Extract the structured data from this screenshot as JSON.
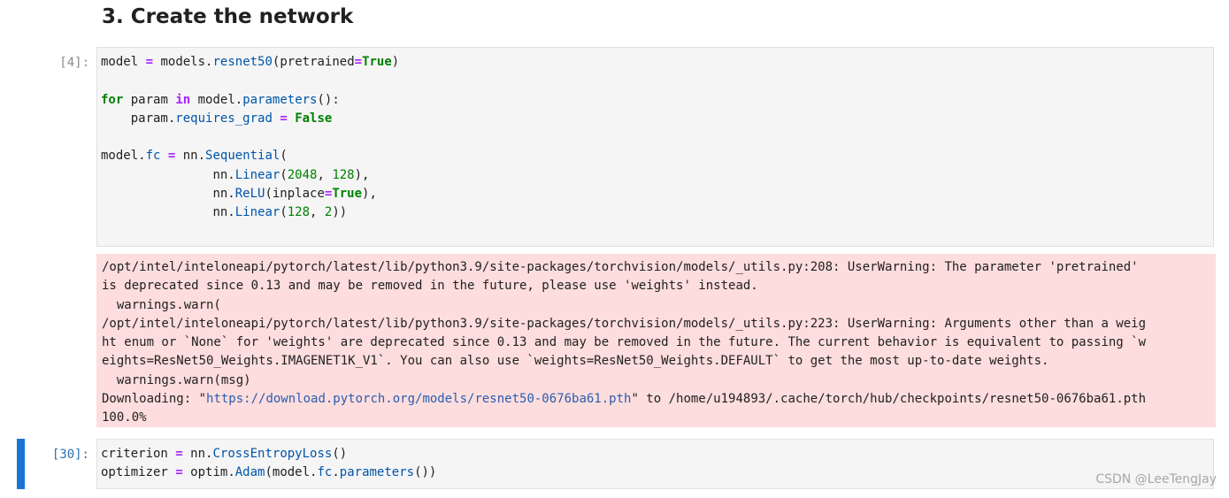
{
  "heading": "3. Create the network",
  "cell1": {
    "prompt": "[4]:",
    "code": {
      "model": "model",
      "eq": "=",
      "models_dot": "models.",
      "resnet50": "resnet50",
      "pretrained_open": "(pretrained",
      "true": "True",
      "close_paren": ")",
      "for": "for",
      "param": "param",
      "in": "in",
      "model_dot": "model.",
      "parameters": "parameters",
      "parens_colon": "():",
      "indent4": "    ",
      "param_dot": "param.",
      "requires_grad": "requires_grad",
      "false": "False",
      "fc": "fc",
      "nn_dot": "nn.",
      "sequential": "Sequential",
      "open_paren": "(",
      "indent15": "               ",
      "linear": "Linear",
      "n2048": "2048",
      "comma_space": ", ",
      "n128": "128",
      "close_comma": "),",
      "relu": "ReLU",
      "inplace": "(inplace",
      "n2": "2",
      "close_double": "))"
    }
  },
  "stderr": {
    "line1": "/opt/intel/inteloneapi/pytorch/latest/lib/python3.9/site-packages/torchvision/models/_utils.py:208: UserWarning: The parameter 'pretrained'",
    "line2": "is deprecated since 0.13 and may be removed in the future, please use 'weights' instead.",
    "line3": "  warnings.warn(",
    "line4": "/opt/intel/inteloneapi/pytorch/latest/lib/python3.9/site-packages/torchvision/models/_utils.py:223: UserWarning: Arguments other than a weig",
    "line5": "ht enum or `None` for 'weights' are deprecated since 0.13 and may be removed in the future. The current behavior is equivalent to passing `w",
    "line6": "eights=ResNet50_Weights.IMAGENET1K_V1`. You can also use `weights=ResNet50_Weights.DEFAULT` to get the most up-to-date weights.",
    "line7": "  warnings.warn(msg)",
    "download_prefix": "Downloading: \"",
    "download_url": "https://download.pytorch.org/models/resnet50-0676ba61.pth",
    "download_suffix": "\" to /home/u194893/.cache/torch/hub/checkpoints/resnet50-0676ba61.pth",
    "progress": "100.0%"
  },
  "cell2": {
    "prompt": "[30]:",
    "code": {
      "criterion": "criterion",
      "eq": "=",
      "nn_dot": "nn.",
      "crossentropy": "CrossEntropyLoss",
      "empty_parens": "()",
      "optimizer": "optimizer",
      "optim_dot": "optim.",
      "adam": "Adam",
      "model_dot_open": "(model.",
      "fc": "fc",
      "dot": ".",
      "parameters": "parameters",
      "close_triple": "())"
    }
  },
  "watermark": "CSDN @LeeTengJay",
  "colors": {
    "keyword": "#008000",
    "operator": "#aa22ff",
    "function": "#0055aa",
    "stderr_bg": "#fddddd",
    "active_bar": "#1976d2"
  }
}
